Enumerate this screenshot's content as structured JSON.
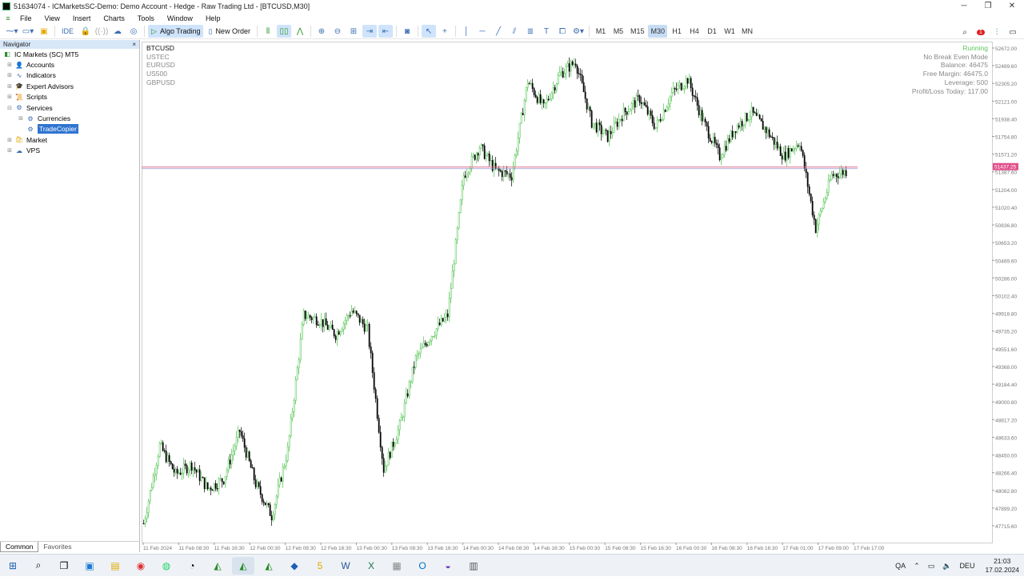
{
  "window": {
    "title": "51634074 - ICMarketsSC-Demo: Demo Account - Hedge - Raw Trading Ltd - [BTCUSD,M30]",
    "controls": [
      "─",
      "❐",
      "✕"
    ]
  },
  "menu": [
    "File",
    "View",
    "Insert",
    "Charts",
    "Tools",
    "Window",
    "Help"
  ],
  "toolbar": {
    "ide_label": "IDE",
    "algo_trading_label": "Algo Trading",
    "new_order_label": "New Order",
    "timeframes": [
      "M1",
      "M5",
      "M15",
      "M30",
      "H1",
      "H4",
      "D1",
      "W1",
      "MN"
    ],
    "active_timeframe": "M30",
    "notification_count": "1"
  },
  "navigator": {
    "title": "Navigator",
    "close": "×",
    "root": "IC Markets (SC) MT5",
    "items": [
      {
        "label": "Accounts",
        "icon": "accounts-icon"
      },
      {
        "label": "Indicators",
        "icon": "indicators-icon"
      },
      {
        "label": "Expert Advisors",
        "icon": "expert-advisors-icon"
      },
      {
        "label": "Scripts",
        "icon": "scripts-icon"
      },
      {
        "label": "Services",
        "icon": "services-icon"
      },
      {
        "label": "Currencies",
        "icon": "gear-icon"
      },
      {
        "label": "TradeCopier",
        "icon": "gear-icon",
        "selected": true
      },
      {
        "label": "Market",
        "icon": "market-icon"
      },
      {
        "label": "VPS",
        "icon": "vps-icon"
      }
    ],
    "tabs": [
      "Common",
      "Favorites"
    ],
    "active_tab": "Common"
  },
  "chart_symbols": [
    "BTCUSD",
    "USTEC",
    "EURUSD",
    "US500",
    "GBPUSD"
  ],
  "ea_status": {
    "running": "Running",
    "mode": "No Break Even Mode",
    "balance": "Balance: 46475",
    "free_margin": "Free Margin: 46475.0",
    "leverage": "Leverage: 500",
    "profit_loss": "Profit/Loss Today: 117.00"
  },
  "chart_data": {
    "type": "candlestick",
    "symbol": "BTCUSD",
    "timeframe": "M30",
    "y_ticks": [
      "52672.00",
      "52489.60",
      "52305.20",
      "52121.00",
      "51938.40",
      "51754.80",
      "51571.20",
      "51387.60",
      "51204.00",
      "51020.40",
      "50836.80",
      "50653.20",
      "50469.60",
      "50286.00",
      "50102.40",
      "49918.80",
      "49735.20",
      "49551.60",
      "49368.00",
      "49184.40",
      "49000.80",
      "48817.20",
      "48633.60",
      "48450.00",
      "48266.40",
      "48082.80",
      "47899.20",
      "47715.60"
    ],
    "current_price": "51437.25",
    "x_ticks": [
      "11 Feb 2024",
      "11 Feb 08:30",
      "11 Feb 16:30",
      "12 Feb 00:30",
      "12 Feb 08:30",
      "12 Feb 16:30",
      "13 Feb 00:30",
      "13 Feb 08:30",
      "13 Feb 16:30",
      "14 Feb 00:30",
      "14 Feb 08:30",
      "14 Feb 16:30",
      "15 Feb 00:30",
      "15 Feb 08:30",
      "15 Feb 16:30",
      "16 Feb 00:30",
      "16 Feb 08:30",
      "16 Feb 16:30",
      "17 Feb 01:00",
      "17 Feb 09:00",
      "17 Feb 17:00"
    ],
    "trend_path": [
      47740,
      48550,
      48250,
      48350,
      48100,
      48200,
      48700,
      48150,
      47820,
      48500,
      49900,
      49850,
      49700,
      49950,
      49750,
      48300,
      48750,
      49450,
      49700,
      49900,
      51350,
      51650,
      51400,
      51350,
      52330,
      52050,
      52400,
      52530,
      51900,
      51750,
      52000,
      52150,
      51850,
      52200,
      52350,
      51900,
      51550,
      51850,
      52000,
      51800,
      51550,
      51700,
      50800,
      51350,
      51400
    ],
    "up_color": "#4ec24e",
    "down_color": "#000000"
  },
  "taskbar": {
    "apps": [
      "start-icon",
      "search-icon",
      "task-view-icon",
      "browser-icon",
      "files-icon",
      "chrome-icon",
      "whatsapp-icon",
      "app-icon",
      "mt5-icon",
      "mt5-icon",
      "mt5-icon",
      "app-icon",
      "app-icon",
      "word-icon",
      "excel-icon",
      "app-icon",
      "outlook-icon",
      "app-icon",
      "app-icon"
    ],
    "lang": "QA",
    "keyboard": "DEU",
    "time": "21:03",
    "date": "17.02.2024"
  }
}
